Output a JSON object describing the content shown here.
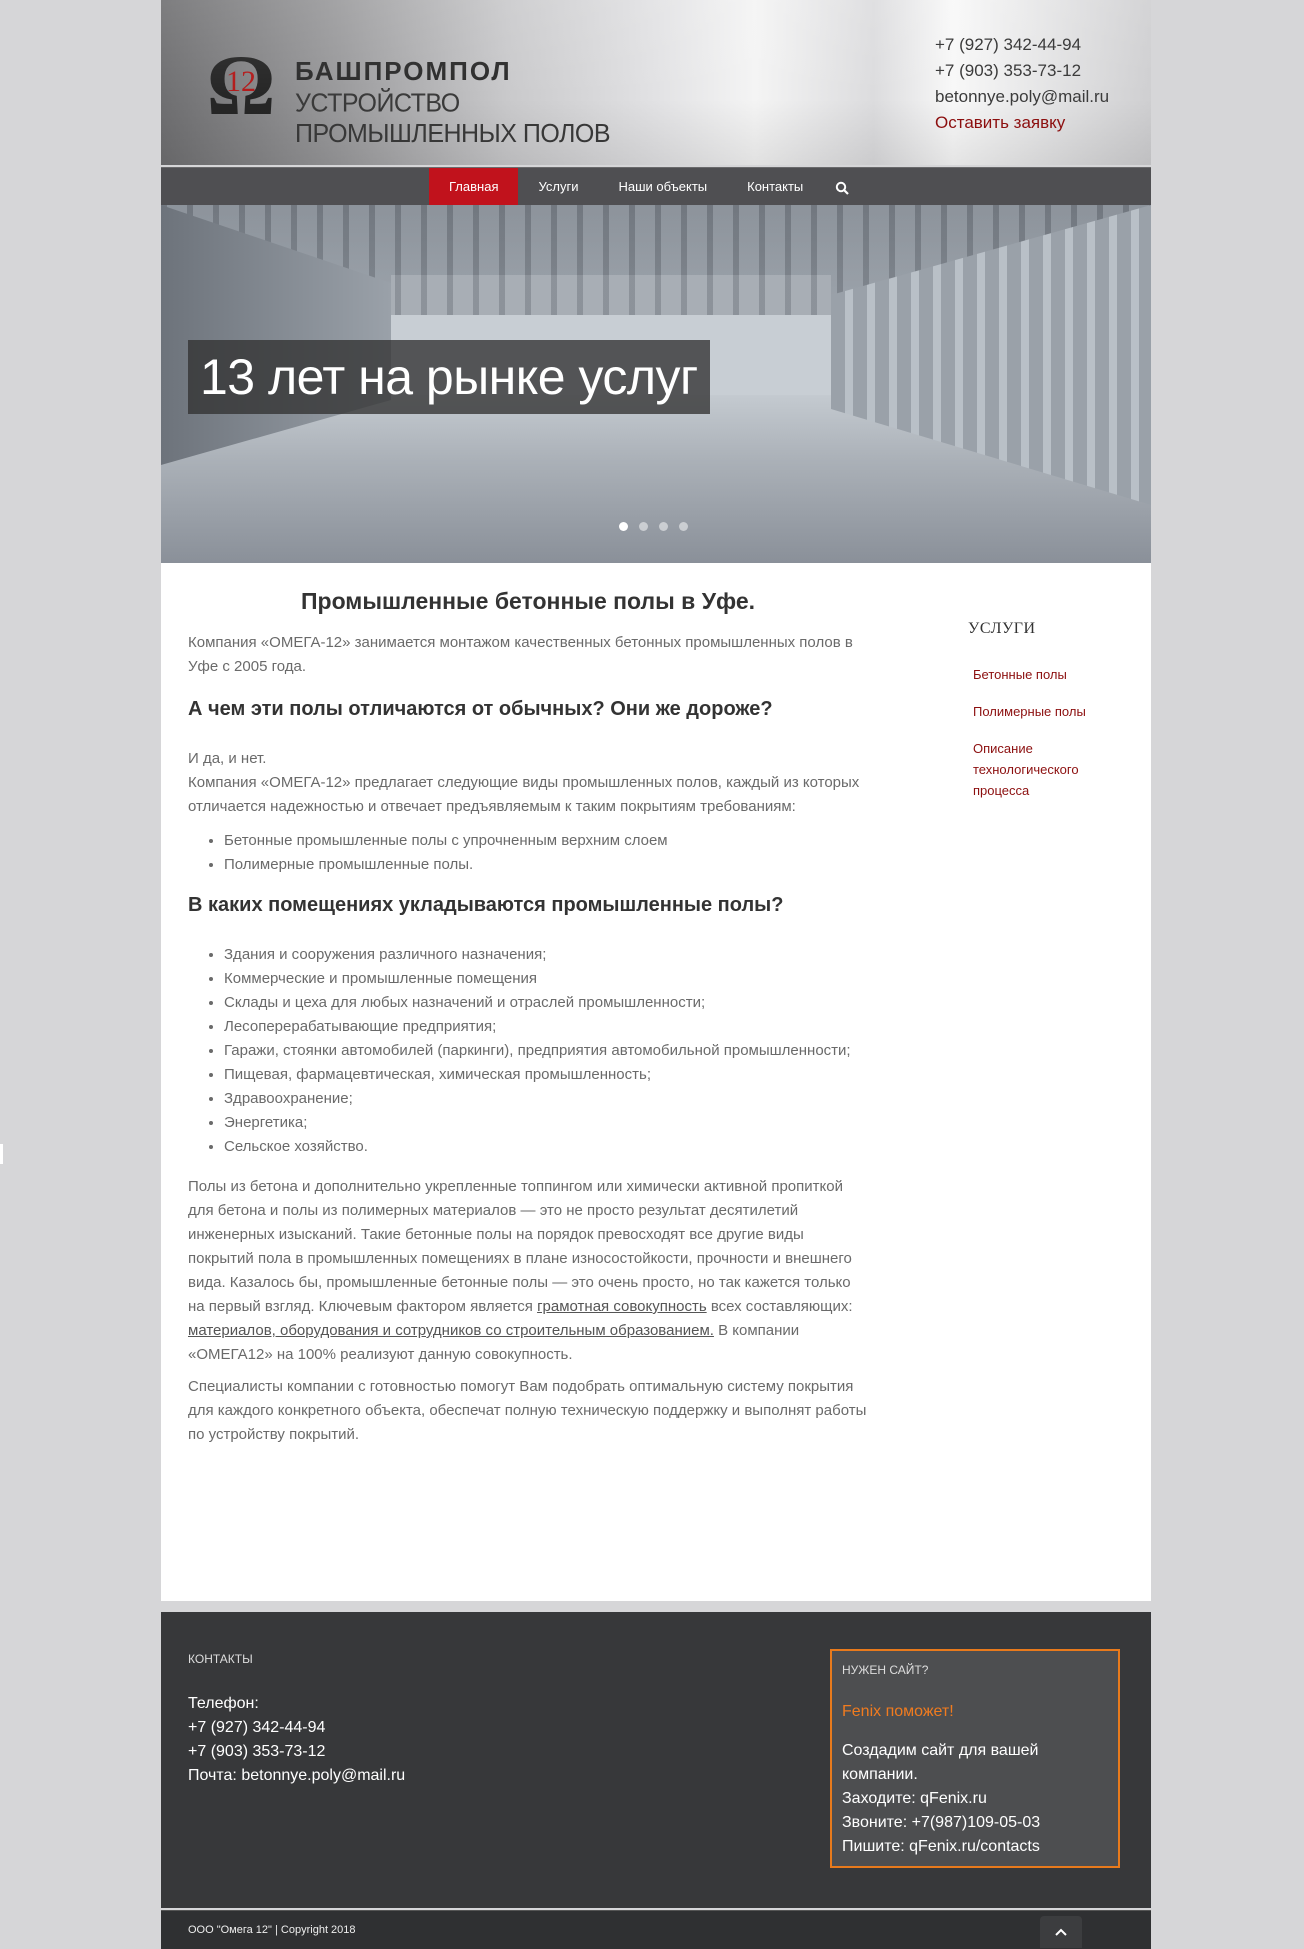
{
  "header": {
    "logo_number": "12",
    "brand": "БАШПРОМПОЛ",
    "tagline": "УСТРОЙСТВО ПРОМЫШЛЕННЫХ ПОЛОВ",
    "phone1": "+7 (927) 342-44-94",
    "phone2": "+7 (903) 353-73-12",
    "email": "betonnye.poly@mail.ru",
    "request": "Оставить заявку"
  },
  "nav": {
    "items": [
      {
        "label": "Главная"
      },
      {
        "label": "Услуги"
      },
      {
        "label": "Наши объекты"
      },
      {
        "label": "Контакты"
      }
    ],
    "search_icon": "search-icon"
  },
  "slider": {
    "caption": "13 лет на рынке услуг",
    "active_slide": 1,
    "slide_count": 4
  },
  "content": {
    "title": "Промышленные бетонные полы в Уфе.",
    "intro": "Компания «ОМЕГА-12» занимается монтажом качественных бетонных промышленных полов в Уфе с 2005 года.",
    "h2_1": "А чем эти полы отличаются от обычных? Они же дороже?",
    "p1_a": "И да, и нет.",
    "p1_b": "Компания «ОМЕГА-12» предлагает следующие виды промышленных полов, каждый из которых отличается надежностью и отвечает предъявляемым к таким покрытиям требованиям:",
    "list1": [
      "Бетонные промышленные полы с упрочненным верхним слоем",
      "Полимерные промышленные полы."
    ],
    "h2_2": "В каких помещениях укладываются промышленные полы?",
    "list2": [
      "Здания и сооружения различного назначения;",
      "Коммерческие и промышленные помещения",
      "Склады и цеха для любых назначений и отраслей промышленности;",
      "Лесоперерабатывающие предприятия;",
      "Гаражи, стоянки автомобилей (паркинги), предприятия автомобильной промышленности;",
      "Пищевая, фармацевтическая, химическая промышленность;",
      "Здравоохранение;",
      "Энергетика;",
      "Сельское хозяйство."
    ],
    "p2_a": "Полы из бетона и дополнительно укрепленные топпингом или химически активной пропиткой для бетона и полы из полимерных материалов — это не просто результат десятилетий инженерных изысканий. Такие бетонные полы на порядок превосходят все другие виды покрытий пола в промышленных помещениях в плане износостойкости, прочности и внешнего вида. Казалось бы, промышленные бетонные полы — это очень просто, но так кажется только на первый взгляд. Ключевым фактором является ",
    "p2_u1": "грамотная совокупность",
    "p2_b": " всех составляющих: ",
    "p2_u2": "материалов, оборудования и сотрудников со строительным образованием.",
    "p2_c": " В компании «ОМЕГА12» на 100% реализуют данную совокупность.",
    "p3": "Специалисты компании с готовностью помогут Вам подобрать оптимальную систему покрытия для каждого конкретного объекта, обеспечат полную техническую поддержку и выполнят работы по устройству покрытий."
  },
  "sidebar": {
    "title": "УСЛУГИ",
    "items": [
      {
        "label": "Бетонные полы"
      },
      {
        "label": "Полимерные полы"
      },
      {
        "label": "Описание технологического процесса"
      }
    ]
  },
  "footer": {
    "contacts_title": "КОНТАКТЫ",
    "phone_label": "Телефон:",
    "phone1": "+7 (927) 342-44-94",
    "phone2": "+7 (903) 353-73-12",
    "email_line": "Почта: betonnye.poly@mail.ru",
    "box_title": "НУЖЕН САЙТ?",
    "box_fenix": "Fenix поможет!",
    "box_line1": "Создадим сайт для вашей компании.",
    "box_line2": "Заходите: qFenix.ru",
    "box_line3": "Звоните: +7(987)109-05-03",
    "box_line4": "Пишите: qFenix.ru/contacts",
    "copyright": "ООО \"Омега 12\" | Copyright 2018"
  },
  "colors": {
    "accent_red": "#c1121c",
    "link_red": "#8c0f0f",
    "footer_orange": "#e87a1c"
  }
}
